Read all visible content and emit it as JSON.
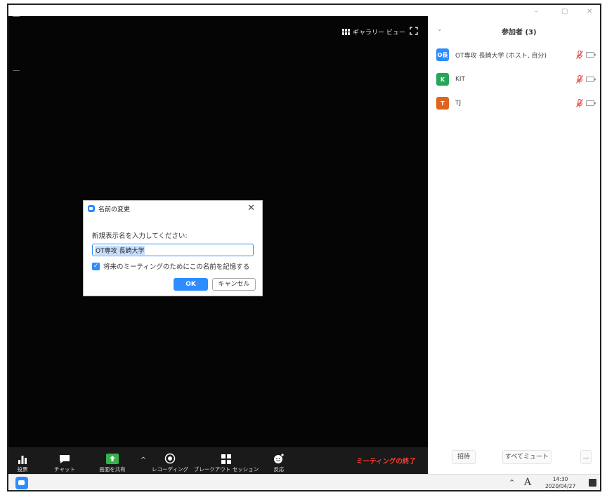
{
  "video": {
    "gallery_view_label": "ギャラリー ビュー"
  },
  "dialog": {
    "title": "名前の変更",
    "prompt": "新規表示名を入力してください:",
    "name_value": "OT専攻 長崎大学",
    "remember_label": "将来のミーティングのためにこの名前を記憶する",
    "remember_checked": true,
    "ok_label": "OK",
    "cancel_label": "キャンセル"
  },
  "toolbar": {
    "poll_label": "投票",
    "chat_label": "チャット",
    "share_label": "画面を共有",
    "record_label": "レコーディング",
    "breakout_label": "ブレークアウト セッション",
    "reactions_label": "反応",
    "end_label": "ミーティングの終了"
  },
  "panel": {
    "title": "参加者 (3)",
    "participants": [
      {
        "avatar": "O長",
        "name": "OT専攻 長崎大学 (ホスト, 自分)",
        "color": "#2d8cff"
      },
      {
        "avatar": "K",
        "name": "KIT",
        "color": "#26a65b"
      },
      {
        "avatar": "T",
        "name": "TJ",
        "color": "#e0631e"
      }
    ],
    "invite_label": "招待",
    "mute_all_label": "すべてミュート",
    "more_label": "..."
  },
  "taskbar": {
    "ime": "A",
    "time": "14:30",
    "date": "2020/04/27"
  },
  "colors": {
    "accent": "#2d8cff",
    "end_red": "#ff3b30",
    "muted_red": "#e0443a",
    "share_green": "#35b24a"
  }
}
